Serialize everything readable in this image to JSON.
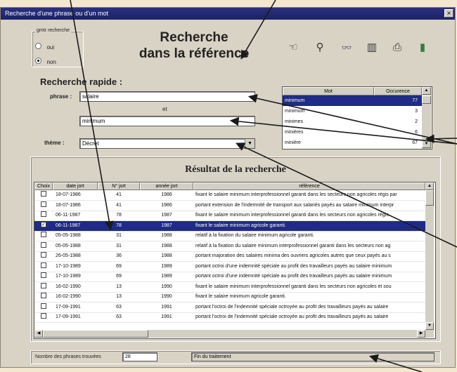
{
  "window": {
    "title": "Recherche d'une phrase ou d'un mot",
    "close": "×"
  },
  "grouping": {
    "title": "gmtr recherche",
    "options": [
      "oui",
      "non"
    ],
    "selected": 1
  },
  "header": {
    "line1": "Recherche",
    "line2": "dans la référence"
  },
  "toolbar": {
    "icons": [
      "pointing-hand-icon",
      "lightbulb-icon",
      "binoculars-icon",
      "document-icon",
      "printer-icon",
      "exit-door-icon"
    ],
    "glyphs": [
      "☜",
      "⚲",
      "👓",
      "▥",
      "⎙",
      "▮"
    ]
  },
  "quick": {
    "title": "Recherche rapide :",
    "phrase_label": "phrase :",
    "phrase_value": "salaire",
    "et_label": "et",
    "second_value": "minimum",
    "theme_label": "thème :",
    "theme_value": "Décret"
  },
  "wordlist": {
    "col_word": "Mot",
    "col_count": "Occurence",
    "rows": [
      {
        "word": "minimum",
        "count": "77"
      },
      {
        "word": "minimum",
        "count": "3"
      },
      {
        "word": "minimes",
        "count": "2"
      },
      {
        "word": "minières",
        "count": "6"
      },
      {
        "word": "minière",
        "count": "67"
      }
    ]
  },
  "results": {
    "title": "Résultat de la recherche",
    "columns": [
      "Choix",
      "date jort",
      "N° jort",
      "année jort",
      "référence"
    ],
    "rows": [
      {
        "checked": false,
        "date": "18-07-1986",
        "num": "41",
        "year": "1986",
        "ref": "fixant le salaire minimum interprofessionnel garanti dans les secteurs non agricoles régis par"
      },
      {
        "checked": false,
        "date": "18-07-1986",
        "num": "41",
        "year": "1986",
        "ref": "portant extension de l'indemnité de transport aux salariés payés au salaire minimum interpr"
      },
      {
        "checked": false,
        "date": "06-11-1987",
        "num": "78",
        "year": "1987",
        "ref": "fixant le salaire minimum interprofessionnel garanti dans les secteurs non agricoles régis"
      },
      {
        "checked": true,
        "date": "06-11-1987",
        "num": "78",
        "year": "1987",
        "ref": "fixant le salaire minimum agricole garanti."
      },
      {
        "checked": false,
        "date": "05-05-1988",
        "num": "31",
        "year": "1988",
        "ref": "relatif à la fixation du salaire minimum agricole garanti."
      },
      {
        "checked": false,
        "date": "05-05-1988",
        "num": "31",
        "year": "1988",
        "ref": "relatif à la fixation du salaire minimum interprofessionnel garanti dans les secteurs non ag"
      },
      {
        "checked": false,
        "date": "26-05-1988",
        "num": "36",
        "year": "1988",
        "ref": "portant majoration des salaires minima des ouvriers agricoles autres que ceux payés au s"
      },
      {
        "checked": false,
        "date": "17-10-1989",
        "num": "69",
        "year": "1989",
        "ref": "portant octroi d'une indemnité spéciale au profit des travailleurs payés au salaire minimum"
      },
      {
        "checked": false,
        "date": "17-10-1989",
        "num": "69",
        "year": "1989",
        "ref": "portant octroi d'une indemnité spéciale au profit des travailleurs payés au salaire minimum"
      },
      {
        "checked": false,
        "date": "16-02-1990",
        "num": "13",
        "year": "1990",
        "ref": "fixant le salaire minimum interprofessionnel garanti dans les secteurs non agricoles et sou"
      },
      {
        "checked": false,
        "date": "16-02-1990",
        "num": "13",
        "year": "1990",
        "ref": "fixant le salaire minimum agricole garanti."
      },
      {
        "checked": false,
        "date": "17-09-1991",
        "num": "63",
        "year": "1991",
        "ref": "portant l'octroi de l'indemnité spéciale octroyée au profit des travailleurs payés au salaire"
      },
      {
        "checked": false,
        "date": "17-09-1991",
        "num": "63",
        "year": "1991",
        "ref": "portant l'octroi de l'indemnité spéciale octroyée au profit des travailleurs payés au salaire"
      }
    ]
  },
  "status": {
    "count_label": "Nombre des phrases trouvées",
    "count_value": "28",
    "message": "Fin du traitement"
  }
}
